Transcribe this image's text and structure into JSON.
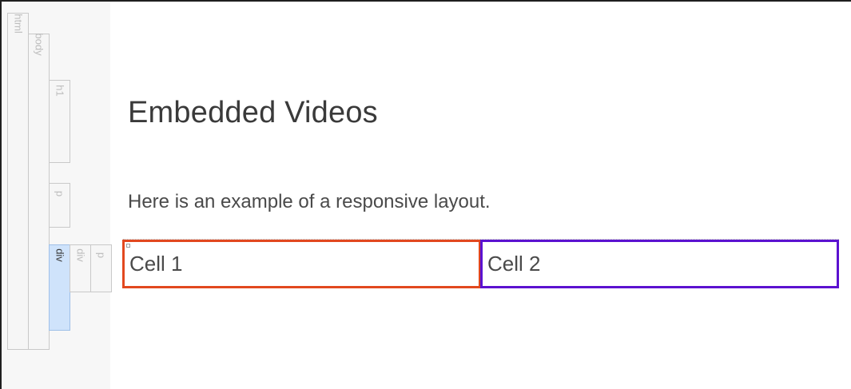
{
  "tags": {
    "html": "html",
    "body": "body",
    "h1": "h1",
    "p1": "p",
    "div": "div",
    "div2": "div",
    "p2": "p"
  },
  "content": {
    "heading": "Embedded Videos",
    "paragraph": "Here is an example of a responsive layout.",
    "cell_1": "Cell 1",
    "cell_2": "Cell 2"
  },
  "colors": {
    "cell_1_border": "#e2481f",
    "cell_2_border": "#5b12d0",
    "active_tag": "#cfe3fb"
  }
}
